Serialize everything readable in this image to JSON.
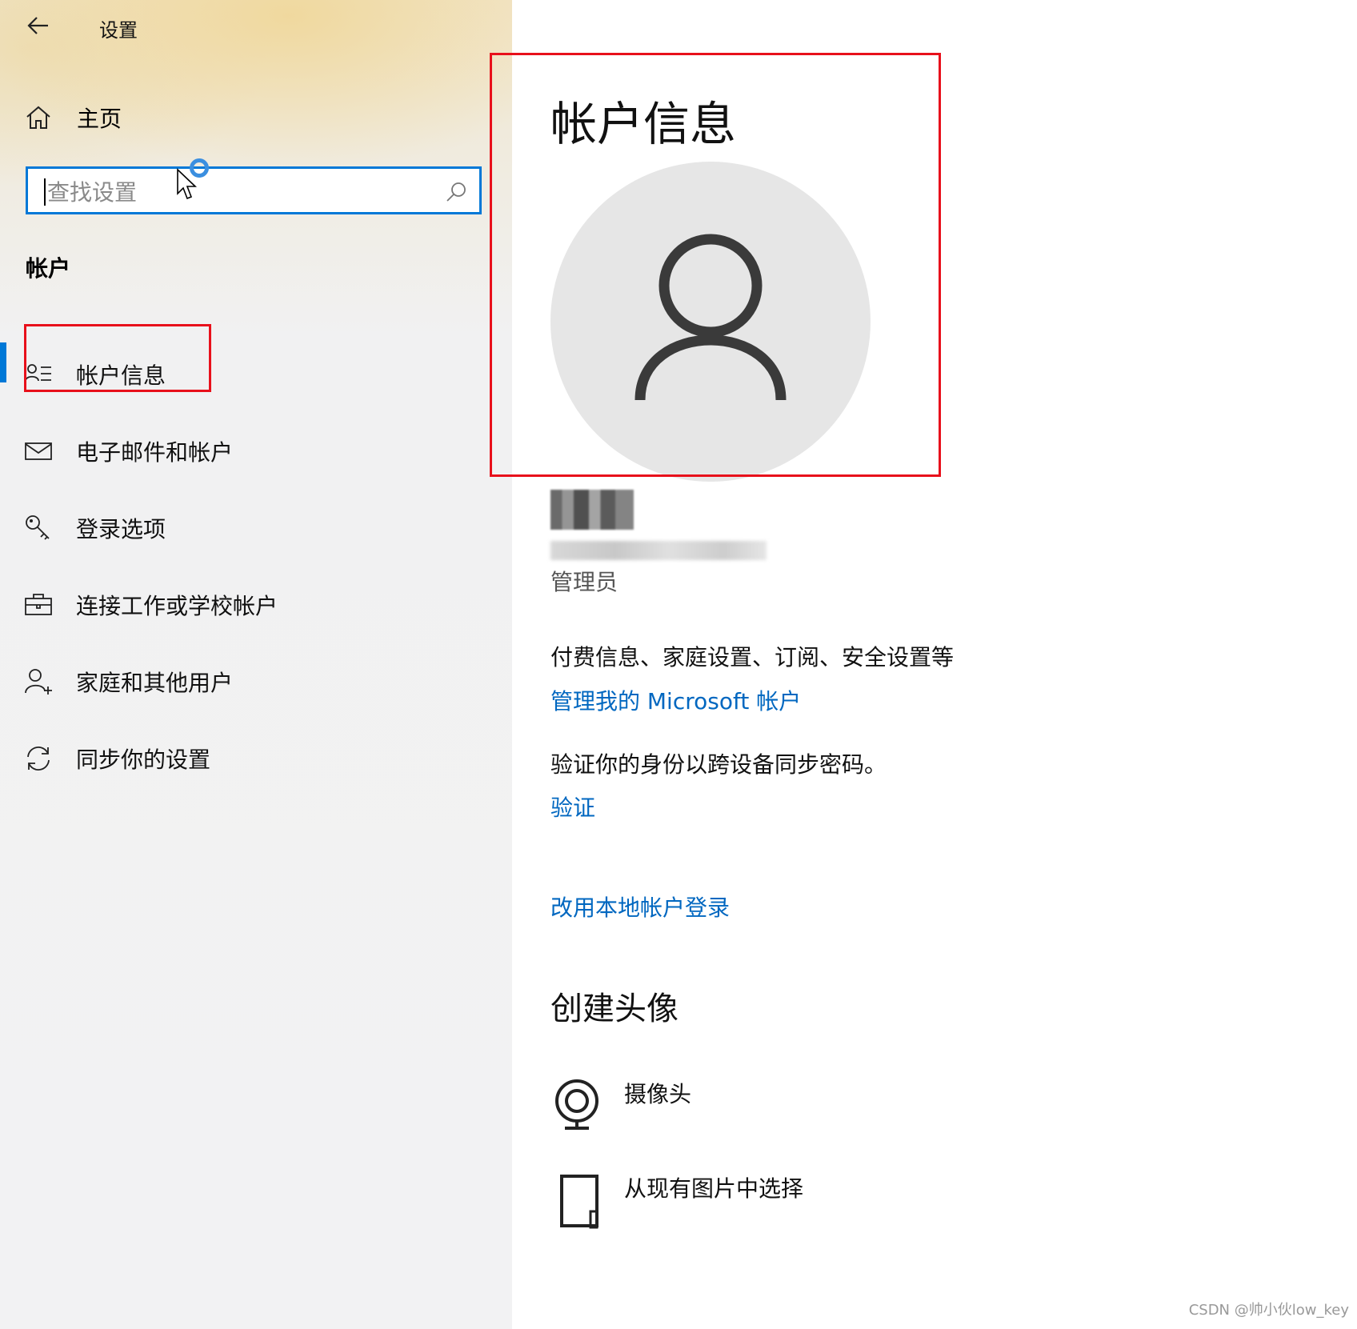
{
  "app": {
    "title": "设置"
  },
  "sidebar": {
    "home_label": "主页",
    "search": {
      "placeholder": "查找设置",
      "value": ""
    },
    "section_heading": "帐户",
    "items": [
      {
        "label": "帐户信息",
        "icon": "account-info-icon",
        "selected": true
      },
      {
        "label": "电子邮件和帐户",
        "icon": "mail-icon",
        "selected": false
      },
      {
        "label": "登录选项",
        "icon": "key-icon",
        "selected": false
      },
      {
        "label": "连接工作或学校帐户",
        "icon": "briefcase-icon",
        "selected": false
      },
      {
        "label": "家庭和其他用户",
        "icon": "person-add-icon",
        "selected": false
      },
      {
        "label": "同步你的设置",
        "icon": "sync-icon",
        "selected": false
      }
    ]
  },
  "main": {
    "title": "帐户信息",
    "user": {
      "role": "管理员"
    },
    "microsoft_account": {
      "description": "付费信息、家庭设置、订阅、安全设置等",
      "link": "管理我的 Microsoft 帐户"
    },
    "verify": {
      "description": "验证你的身份以跨设备同步密码。",
      "link": "验证"
    },
    "local_account_link": "改用本地帐户登录",
    "create_avatar": {
      "heading": "创建头像",
      "options": [
        {
          "label": "摄像头",
          "icon": "webcam-icon"
        },
        {
          "label": "从现有图片中选择",
          "icon": "image-file-icon"
        }
      ]
    }
  },
  "watermark": "CSDN @帅小伙low_key",
  "colors": {
    "accent": "#0078d7",
    "link": "#0067c0",
    "highlight_box": "#e8101b",
    "avatar_bg": "#e6e6e6"
  }
}
